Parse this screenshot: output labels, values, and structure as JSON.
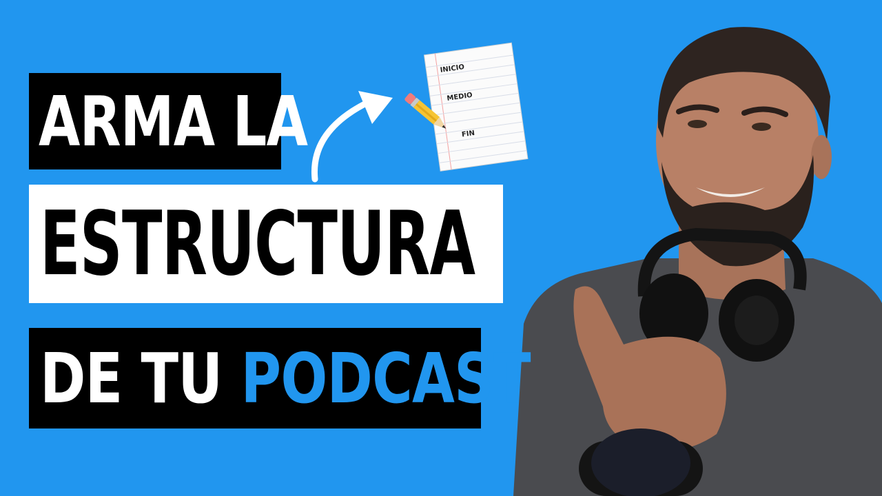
{
  "headline": {
    "line1": "ARMA LA",
    "line2": "ESTRUCTURA",
    "line3_prefix": "DE TU",
    "line3_highlight": "PODCAST"
  },
  "notepad": {
    "labels": [
      "INICIO",
      "MEDIO",
      "FIN"
    ]
  },
  "colors": {
    "background": "#2196ef",
    "highlight": "#2196ef",
    "box_dark": "#000000",
    "box_light": "#ffffff"
  },
  "icons": [
    "curved-arrow-icon",
    "pencil-icon",
    "notepad-icon",
    "headphones-icon",
    "microphone-icon"
  ]
}
